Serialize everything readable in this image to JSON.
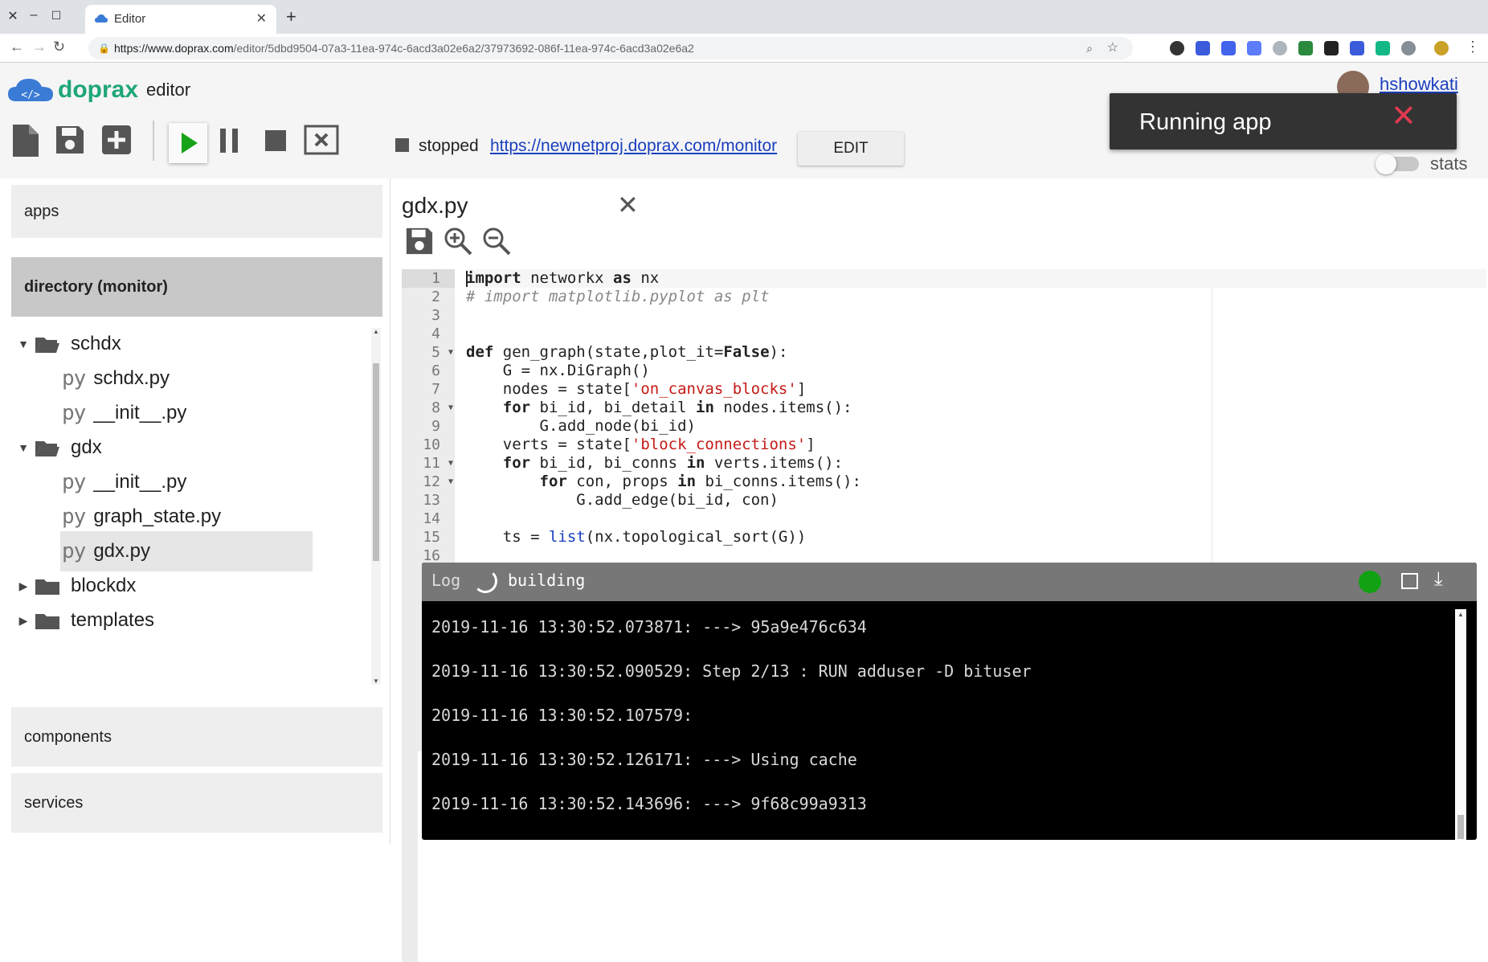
{
  "browser": {
    "tab_title": "Editor",
    "url_host": "https://www.doprax.com",
    "url_path": "/editor/5dbd9504-07a3-11ea-974c-6acd3a02e6a2/37973692-086f-11ea-974c-6acd3a02e6a2"
  },
  "header": {
    "logo_word": "doprax",
    "logo_sub": "editor",
    "logo_badge": "</>",
    "user": "hshowkati",
    "status": "stopped",
    "app_url": "https://newnetproj.doprax.com/monitor",
    "edit_label": "EDIT",
    "stats_label": "stats"
  },
  "toast": {
    "message": "Running app",
    "close_glyph": "✕"
  },
  "sidebar": {
    "apps_label": "apps",
    "directory_label": "directory (monitor)",
    "components_label": "components",
    "services_label": "services",
    "tree": [
      {
        "type": "folder",
        "label": "schdx",
        "open": true
      },
      {
        "type": "file",
        "label": "schdx.py"
      },
      {
        "type": "file",
        "label": "__init__.py"
      },
      {
        "type": "folder",
        "label": "gdx",
        "open": true
      },
      {
        "type": "file",
        "label": "__init__.py"
      },
      {
        "type": "file",
        "label": "graph_state.py"
      },
      {
        "type": "file",
        "label": "gdx.py",
        "selected": true
      },
      {
        "type": "folder",
        "label": "blockdx",
        "open": false
      },
      {
        "type": "folder",
        "label": "templates",
        "open": false
      }
    ],
    "py_glyph": "py"
  },
  "editor": {
    "filename": "gdx.py",
    "close_glyph": "✕",
    "line_numbers": [
      "1",
      "2",
      "3",
      "4",
      "5",
      "6",
      "7",
      "8",
      "9",
      "10",
      "11",
      "12",
      "13",
      "14",
      "15",
      "16"
    ],
    "fold_lines": [
      "5",
      "8",
      "11",
      "12"
    ],
    "code": [
      [
        {
          "t": "import",
          "c": "kw"
        },
        {
          "t": " networkx "
        },
        {
          "t": "as",
          "c": "kw"
        },
        {
          "t": " nx"
        }
      ],
      [
        {
          "t": "# import matplotlib.pyplot as plt",
          "c": "cm"
        }
      ],
      [],
      [],
      [
        {
          "t": "def",
          "c": "kw"
        },
        {
          "t": " gen_graph(state,plot_it="
        },
        {
          "t": "False",
          "c": "kw"
        },
        {
          "t": "):"
        }
      ],
      [
        {
          "t": "    G = nx.DiGraph()"
        }
      ],
      [
        {
          "t": "    nodes = state["
        },
        {
          "t": "'on_canvas_blocks'",
          "c": "st"
        },
        {
          "t": "]"
        }
      ],
      [
        {
          "t": "    "
        },
        {
          "t": "for",
          "c": "kw"
        },
        {
          "t": " bi_id, bi_detail "
        },
        {
          "t": "in",
          "c": "kw"
        },
        {
          "t": " nodes.items():"
        }
      ],
      [
        {
          "t": "        G.add_node(bi_id)"
        }
      ],
      [
        {
          "t": "    verts = state["
        },
        {
          "t": "'block_connections'",
          "c": "st"
        },
        {
          "t": "]"
        }
      ],
      [
        {
          "t": "    "
        },
        {
          "t": "for",
          "c": "kw"
        },
        {
          "t": " bi_id, bi_conns "
        },
        {
          "t": "in",
          "c": "kw"
        },
        {
          "t": " verts.items():"
        }
      ],
      [
        {
          "t": "        "
        },
        {
          "t": "for",
          "c": "kw"
        },
        {
          "t": " con, props "
        },
        {
          "t": "in",
          "c": "kw"
        },
        {
          "t": " bi_conns.items():"
        }
      ],
      [
        {
          "t": "            G.add_edge(bi_id, con)"
        }
      ],
      [],
      [
        {
          "t": "    ts = "
        },
        {
          "t": "list",
          "c": "fn"
        },
        {
          "t": "(nx.topological_sort(G))"
        }
      ],
      []
    ]
  },
  "log": {
    "title": "Log",
    "state": "building",
    "download_glyph": "⤓",
    "lines": [
      "2019-11-16 13:30:52.073871: ---> 95a9e476c634",
      "2019-11-16 13:30:52.090529: Step 2/13 : RUN adduser -D bituser",
      "2019-11-16 13:30:52.107579:",
      "2019-11-16 13:30:52.126171: ---> Using cache",
      "2019-11-16 13:30:52.143696: ---> 9f68c99a9313"
    ]
  },
  "colors": {
    "brand": "#1fa67a",
    "link": "#1a3fbf",
    "toast_close": "#e03a50",
    "log_status_dot": "#12a112"
  }
}
